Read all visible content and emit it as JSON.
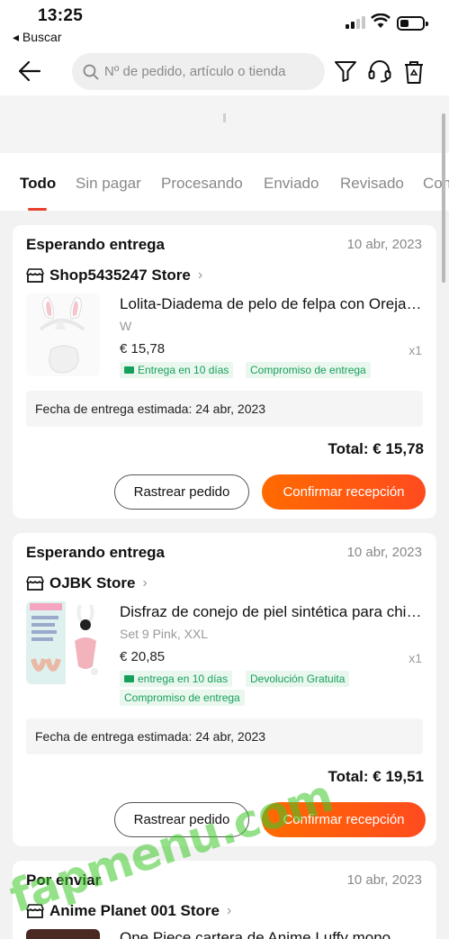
{
  "status_bar": {
    "time": "13:25",
    "back_app": "◂ Buscar"
  },
  "search": {
    "placeholder": "Nº de pedido, artículo o tienda"
  },
  "icons": {
    "back": "arrow-left-icon",
    "filter": "filter-icon",
    "support": "headset-icon",
    "trash": "trash-icon",
    "store": "store-icon"
  },
  "tabs": [
    "Todo",
    "Sin pagar",
    "Procesando",
    "Enviado",
    "Revisado",
    "Con"
  ],
  "orders": [
    {
      "status": "Esperando entrega",
      "date": "10 abr, 2023",
      "store": "Shop5435247 Store",
      "title": "Lolita-Diadema de pelo de felpa con Orejas de conejo",
      "variant": "W",
      "price": "€ 15,78",
      "qty": "x1",
      "tags": [
        "Entrega en 10 días",
        "Compromiso de entrega"
      ],
      "estimated": "Fecha de entrega estimada: 24 abr, 2023",
      "total": "Total: € 15,78",
      "track_label": "Rastrear pedido",
      "confirm_label": "Confirmar recepción"
    },
    {
      "status": "Esperando entrega",
      "date": "10 abr, 2023",
      "store": "OJBK Store",
      "title": "Disfraz de conejo de piel sintética para chica sexy",
      "variant": "Set 9 Pink, XXL",
      "price": "€ 20,85",
      "qty": "x1",
      "tags": [
        "entrega en 10 días",
        "Devolución Gratuita",
        "Compromiso de entrega"
      ],
      "estimated": "Fecha de entrega estimada: 24 abr, 2023",
      "total": "Total: € 19,51",
      "track_label": "Rastrear pedido",
      "confirm_label": "Confirmar recepción"
    },
    {
      "status": "Por enviar",
      "date": "10 abr, 2023",
      "store": "Anime Planet 001 Store",
      "title": "One Piece cartera de Anime Luffy mono"
    }
  ],
  "watermark": "fapmenu.com",
  "colors": {
    "accent": "#e8412c",
    "button_orange": "#ff5a14",
    "tag_green": "#17a05c"
  }
}
